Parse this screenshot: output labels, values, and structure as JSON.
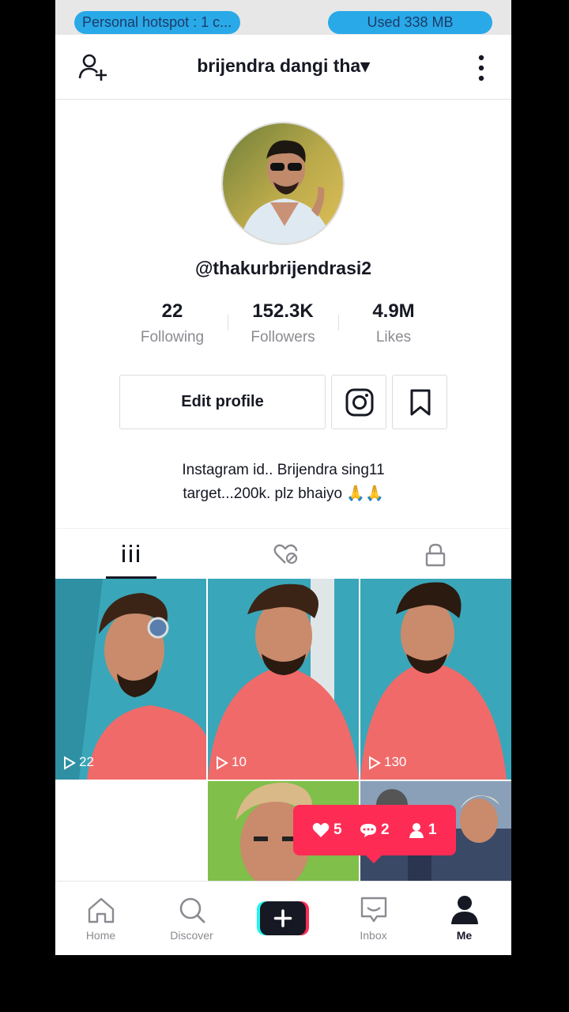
{
  "status": {
    "hotspot": "Personal hotspot : 1 c...",
    "used": "Used  338 MB"
  },
  "header": {
    "title": "brijendra dangi tha▾"
  },
  "profile": {
    "handle": "@thakurbrijendrasi2",
    "stats": [
      {
        "value": "22",
        "label": "Following"
      },
      {
        "value": "152.3K",
        "label": "Followers"
      },
      {
        "value": "4.9M",
        "label": "Likes"
      }
    ],
    "edit_label": "Edit profile",
    "bio_line1": "Instagram id.. Brijendra sing11",
    "bio_line2": "target...200k. plz bhaiyo 🙏🙏"
  },
  "videos": [
    {
      "views": "22"
    },
    {
      "views": "10"
    },
    {
      "views": "130"
    }
  ],
  "notification": {
    "likes": "5",
    "comments": "2",
    "followers": "1"
  },
  "bottom_nav": {
    "home": "Home",
    "discover": "Discover",
    "inbox": "Inbox",
    "me": "Me"
  },
  "colors": {
    "accent": "#fe2c55",
    "pill": "#29a9e8",
    "text": "#161823",
    "muted": "#8a8b91"
  }
}
